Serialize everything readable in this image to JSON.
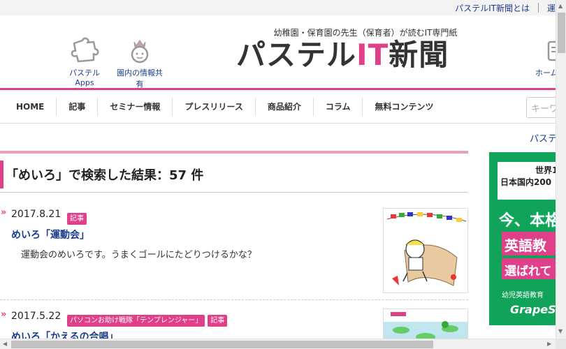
{
  "topbar": {
    "about_link": "パステルIT新聞とは",
    "next_link": "運"
  },
  "header": {
    "apps_label": "パステルApps",
    "share_label": "園内の情報共有",
    "home_label": "ホーム",
    "logo_tagline": "幼稚園・保育園の先生（保育者）が読むIT専門紙",
    "logo_part1": "パステル",
    "logo_part2": "IT",
    "logo_part3": "新聞"
  },
  "nav": {
    "items": [
      "HOME",
      "記事",
      "セミナー情報",
      "プレスリリース",
      "商品紹介",
      "コラム",
      "無料コンテンツ"
    ],
    "search_placeholder": "キーワ"
  },
  "sidebar": {
    "link": "パステ"
  },
  "results": {
    "heading": "「めいろ」で検索した結果：57 件"
  },
  "articles": [
    {
      "date": "2017.8.21",
      "badges": [
        "記事"
      ],
      "title": "めいろ「運動会」",
      "excerpt": "運動会のめいろです。うまくゴールにたどりつけるかな？"
    },
    {
      "date": "2017.5.22",
      "badges": [
        "パソコンお助け戦隊「テンプレンジャー」",
        "記事"
      ],
      "title": "めいろ「かえるの合唱」",
      "excerpt": ""
    }
  ],
  "ad": {
    "top_line1": "世界1",
    "top_line2": "日本国内200",
    "big1": "今、本格",
    "big2": "英語教",
    "big3": "選ばれて",
    "bottom": "幼児英語教育",
    "brand": "GrapeS"
  },
  "colors": {
    "accent": "#e0408a",
    "link": "#1a3c8c",
    "ad_green": "#12a35a"
  }
}
